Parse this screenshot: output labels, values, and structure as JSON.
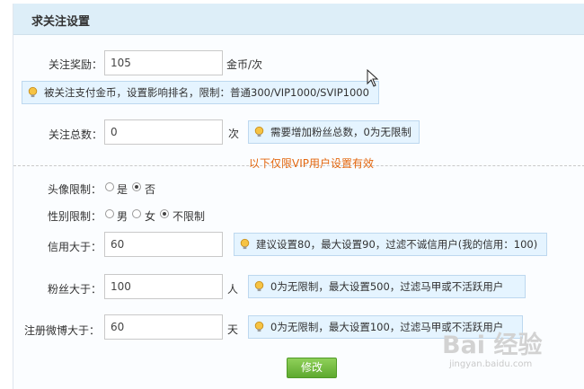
{
  "panel": {
    "title": "求关注设置"
  },
  "reward": {
    "label": "关注奖励：",
    "value": "105",
    "unit": "金币/次",
    "tip": "被关注支付金币，设置影响排名，限制：普通300/VIP1000/SVIP1000"
  },
  "total": {
    "label": "关注总数：",
    "value": "0",
    "unit": "次",
    "tip": "需要增加粉丝总数，0为无限制"
  },
  "vip_note": "以下仅限VIP用户设置有效",
  "avatar": {
    "label": "头像限制：",
    "options": [
      "是",
      "否"
    ],
    "selected": "否"
  },
  "gender": {
    "label": "性别限制：",
    "options": [
      "男",
      "女",
      "不限制"
    ],
    "selected": "不限制"
  },
  "credit": {
    "label": "信用大于：",
    "value": "60",
    "tip": "建议设置80，最大设置90，过滤不诚信用户(我的信用：100)"
  },
  "fans": {
    "label": "粉丝大于：",
    "value": "100",
    "unit": "人",
    "tip": "0为无限制，最大设置500，过滤马甲或不活跃用户"
  },
  "weibo": {
    "label": "注册微博大于：",
    "value": "60",
    "unit": "天",
    "tip": "0为无限制，最大设置100，过滤马甲或不活跃用户"
  },
  "submit_label": "修改",
  "watermark": {
    "main": "Bai 经验",
    "sub": "jingyan.baidu.com"
  },
  "colors": {
    "header_bg": "#ddeef8",
    "tip_bg": "#e5f4ff",
    "note": "#e3670f",
    "button": "#6bb437"
  }
}
